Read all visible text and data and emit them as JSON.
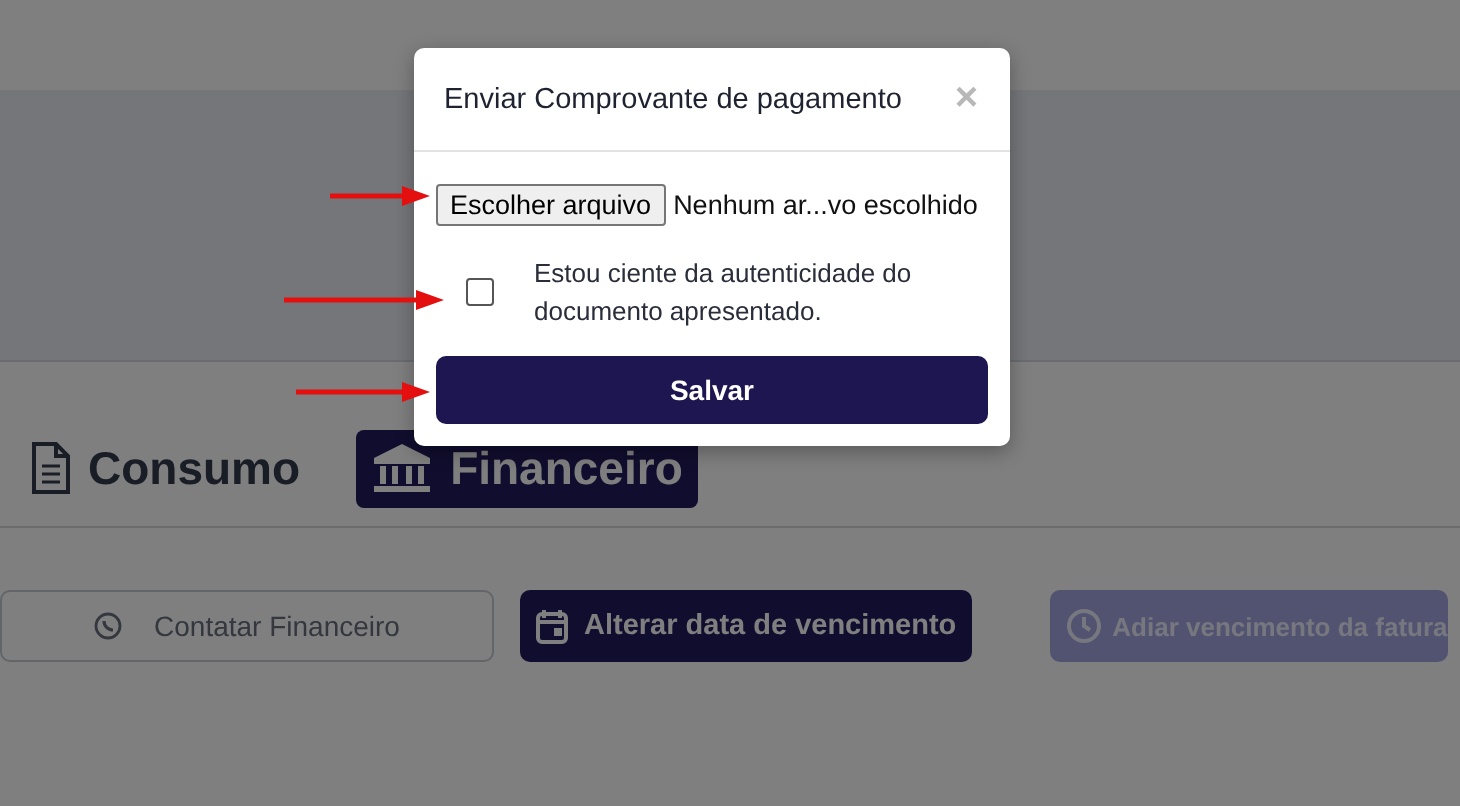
{
  "tabs": [
    {
      "label": "Consumo",
      "selected": false
    },
    {
      "label": "Financeiro",
      "selected": true
    }
  ],
  "actions": [
    {
      "label": "Contatar Financeiro",
      "kind": "outline",
      "disabled": false
    },
    {
      "label": "Alterar data de vencimento",
      "kind": "primary",
      "disabled": false
    },
    {
      "label": "Adiar vencimento da fatura",
      "kind": "primary",
      "disabled": true
    }
  ],
  "modal": {
    "title": "Enviar Comprovante de pagamento",
    "close": "×",
    "file_button": "Escolher arquivo",
    "file_status": "Nenhum ar...vo escolhido",
    "checkbox": {
      "label": "Estou ciente da autenticidade do documento apresentado.",
      "checked": false
    },
    "submit": "Salvar"
  }
}
